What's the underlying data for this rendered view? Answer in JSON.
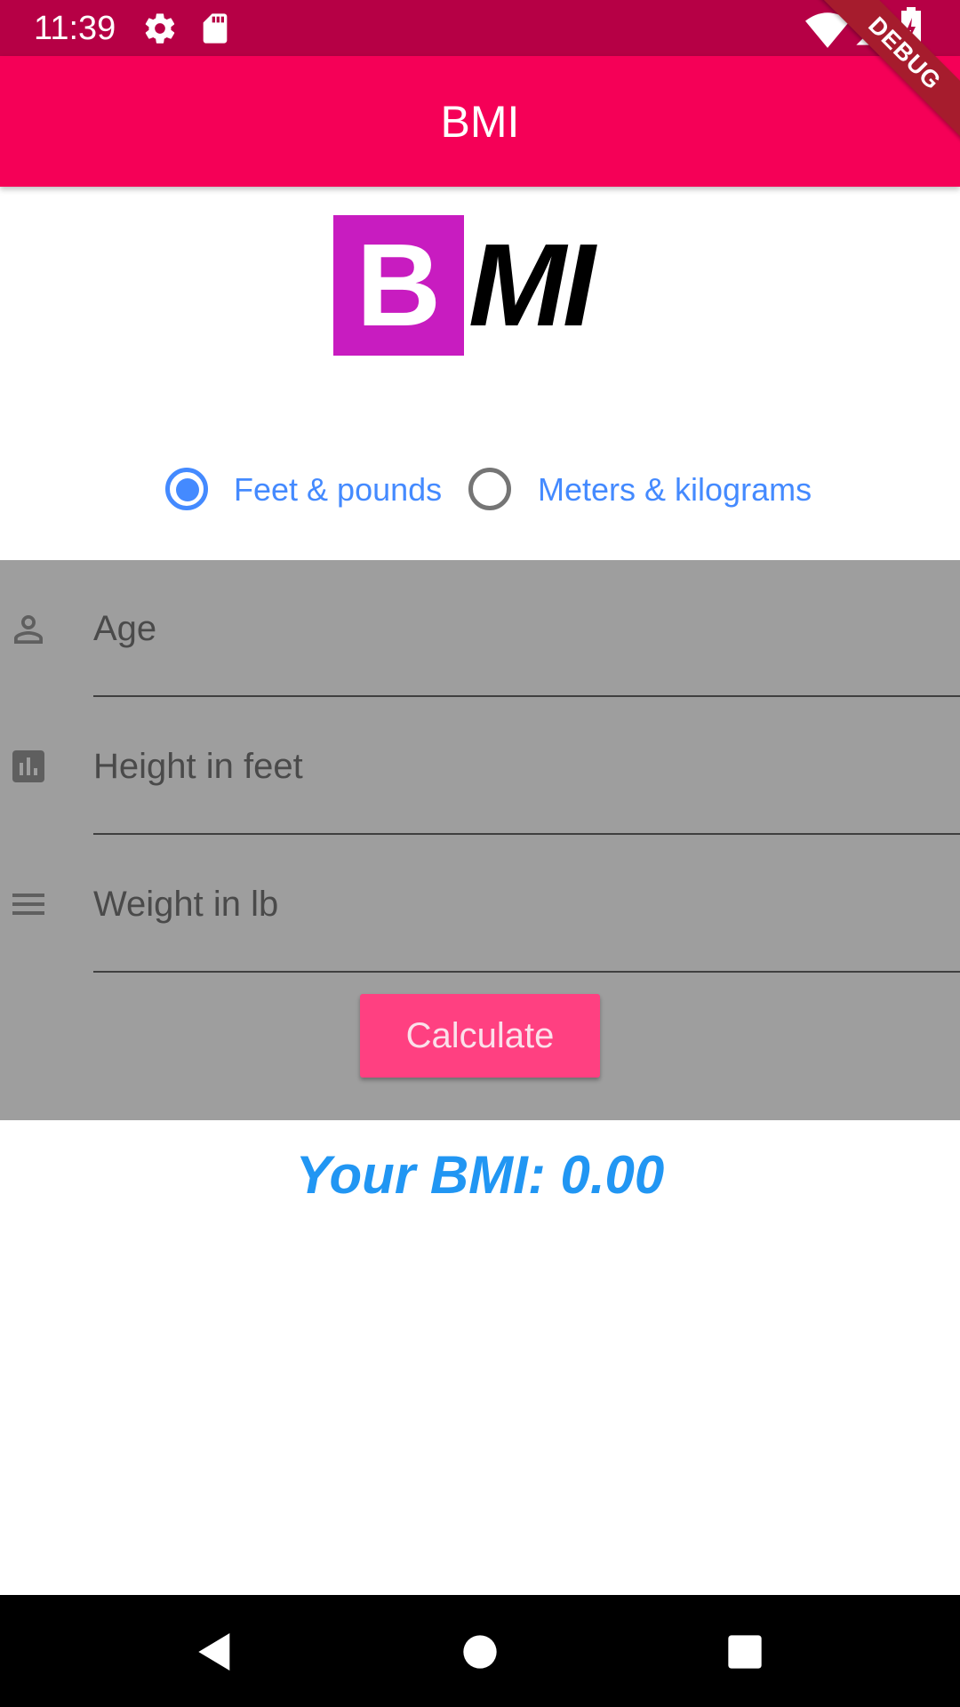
{
  "status_bar": {
    "time": "11:39",
    "icons": [
      "gear-icon",
      "sd-card-icon",
      "wifi-icon",
      "signal-icon",
      "battery-icon"
    ]
  },
  "app_bar": {
    "title": "BMI"
  },
  "debug_banner": "DEBUG",
  "logo": {
    "letter_b": "B",
    "letters_mi": "MI",
    "b_color": "#c81cc0"
  },
  "unit_options": [
    {
      "label": "Feet & pounds",
      "selected": true
    },
    {
      "label": "Meters & kilograms",
      "selected": false
    }
  ],
  "form": {
    "age": {
      "placeholder": "Age",
      "value": "",
      "icon": "person-icon"
    },
    "height": {
      "placeholder": "Height in feet",
      "value": "",
      "icon": "bar-chart-icon"
    },
    "weight": {
      "placeholder": "Weight in lb",
      "value": "",
      "icon": "menu-lines-icon"
    },
    "calculate_label": "Calculate"
  },
  "result": {
    "text": "Your BMI: 0.00"
  },
  "nav_bar": {
    "icons": [
      "back-icon",
      "home-icon",
      "recents-icon"
    ]
  },
  "colors": {
    "status_bar": "#b60045",
    "app_bar": "#f50057",
    "accent": "#448aff",
    "button": "#ff4081",
    "result": "#2196f3",
    "panel": "#9e9e9e"
  }
}
